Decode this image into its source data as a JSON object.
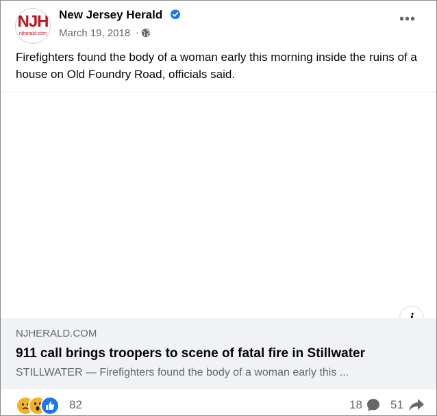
{
  "post": {
    "page_name": "New Jersey Herald",
    "avatar_logo": "NJH",
    "avatar_sub": "njherald.com",
    "date": "March 19, 2018",
    "separator": "·",
    "text": "Firefighters found the body of a woman early this morning inside the ruins of a house on Old Foundry Road, officials said.",
    "more_label": "•••"
  },
  "link": {
    "domain": "NJHERALD.COM",
    "title": "911 call brings troopers to scene of fatal fire in Stillwater",
    "description": "STILLWATER — Firefighters found the body of a woman early this ...",
    "info_label": "i"
  },
  "footer": {
    "reaction_count": "82",
    "reactions": [
      "sad",
      "wow",
      "like"
    ],
    "comment_count": "18",
    "share_count": "51"
  },
  "colors": {
    "brand_blue": "#1877f2",
    "logo_red": "#c1121f",
    "secondary_text": "#65676b",
    "card_bg": "#f0f2f5"
  }
}
